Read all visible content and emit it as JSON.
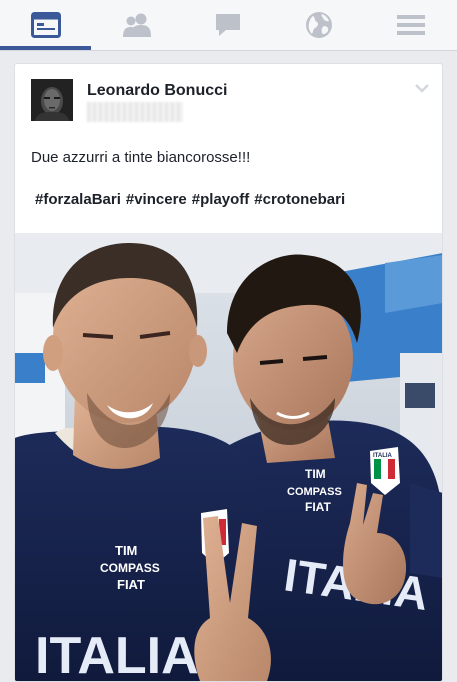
{
  "nav": {
    "tabs": [
      {
        "name": "news-feed",
        "icon": "news-feed-icon",
        "active": true
      },
      {
        "name": "friend-requests",
        "icon": "friends-icon",
        "active": false
      },
      {
        "name": "messages",
        "icon": "messages-icon",
        "active": false
      },
      {
        "name": "notifications",
        "icon": "globe-icon",
        "active": false
      },
      {
        "name": "more",
        "icon": "menu-icon",
        "active": false
      }
    ],
    "colors": {
      "active": "#3b5998",
      "inactive": "#bdc1c9"
    }
  },
  "post": {
    "author": "Leonardo Bonucci",
    "text": "Due azzurri a tinte biancorosse!!!",
    "hashtags": [
      "#forzalaBari",
      "#vincere",
      "#playoff",
      "#crotonebari"
    ]
  },
  "photo": {
    "shirt_text_left": "ITALIA",
    "shirt_text_right": "ITALIA",
    "sponsor_lines": [
      "TIM",
      "COMPASS",
      "FIAT"
    ],
    "badge_text": "ITALIA"
  }
}
